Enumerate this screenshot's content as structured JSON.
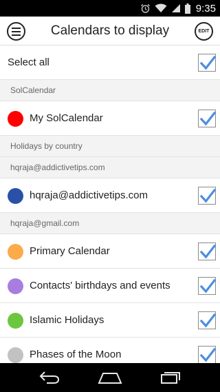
{
  "status_bar": {
    "time": "9:35",
    "icons": [
      "alarm-icon",
      "wifi-icon",
      "signal-icon",
      "battery-icon"
    ]
  },
  "header": {
    "title": "Calendars to display",
    "menu_icon": "menu-icon",
    "edit_label": "EDIT"
  },
  "select_all": {
    "label": "Select all",
    "checked": true
  },
  "sections": [
    {
      "title": "SolCalendar",
      "items": [
        {
          "label": "My SolCalendar",
          "color": "#ff0000",
          "checked": true
        }
      ]
    },
    {
      "title": "Holidays by country",
      "items": []
    },
    {
      "title": "hqraja@addictivetips.com",
      "items": [
        {
          "label": "hqraja@addictivetips.com",
          "color": "#2b51a6",
          "checked": true
        }
      ]
    },
    {
      "title": "hqraja@gmail.com",
      "items": [
        {
          "label": "Primary Calendar",
          "color": "#fbab4a",
          "checked": true
        },
        {
          "label": "Contacts' birthdays and events",
          "color": "#a87de0",
          "checked": true
        },
        {
          "label": "Islamic Holidays",
          "color": "#6cc63e",
          "checked": true
        },
        {
          "label": "Phases of the Moon",
          "color": "#c2c2c2",
          "checked": true
        }
      ]
    }
  ],
  "colors": {
    "checkmark": "#4a8ee0"
  },
  "nav_bar": {
    "icons": [
      "back-icon",
      "home-icon",
      "recent-apps-icon"
    ]
  }
}
